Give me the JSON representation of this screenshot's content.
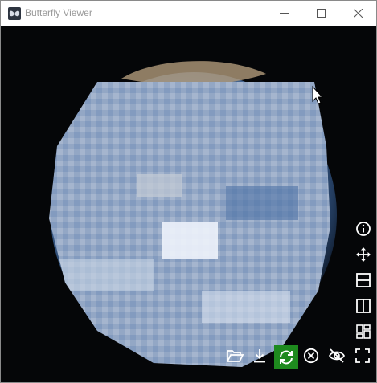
{
  "window": {
    "title": "Butterfly Viewer",
    "app_icon": "butterfly-icon",
    "controls": [
      "minimize-icon",
      "maximize-icon",
      "close-icon"
    ]
  },
  "toolbar": {
    "right_column": [
      "info-icon",
      "move-arrows-icon",
      "split-horizontal-icon",
      "split-vertical-icon",
      "grid-layout-icon"
    ],
    "bottom_row": [
      "open-folder-icon",
      "download-icon",
      "sync-icon",
      "close-circle-icon",
      "hide-eye-icon",
      "fullscreen-icon"
    ],
    "active": "sync-icon",
    "active_color": "#1e8a1e"
  },
  "colors": {
    "background": "#050608",
    "icon": "#ffffff"
  }
}
